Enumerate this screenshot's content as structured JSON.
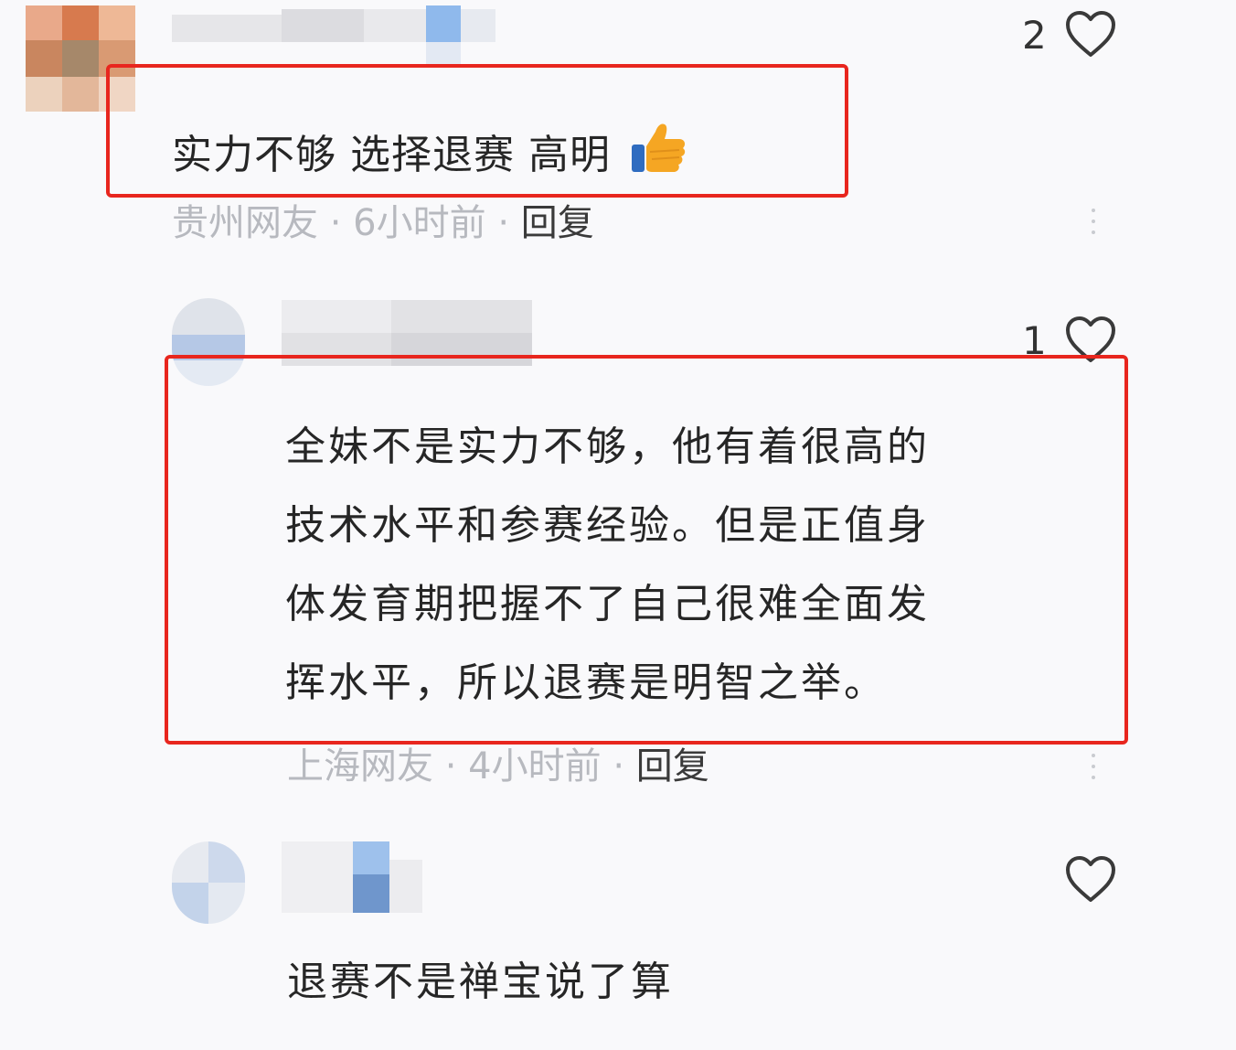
{
  "comments": [
    {
      "like_count": "2",
      "text": "实力不够 选择退赛 高明",
      "emoji": "thumbs-up",
      "location": "贵州网友",
      "time": "6小时前",
      "reply_label": "回复"
    },
    {
      "like_count": "1",
      "text_lines": [
        "全妹不是实力不够，他有着很高的",
        "技术水平和参赛经验。但是正值身",
        "体发育期把握不了自己很难全面发",
        "挥水平，所以退赛是明智之举。"
      ],
      "location": "上海网友",
      "time": "4小时前",
      "reply_label": "回复"
    },
    {
      "like_count": "",
      "text": "退赛不是禅宝说了算"
    }
  ],
  "separator": "·",
  "colors": {
    "highlight_border": "#e8261e",
    "meta_text": "#b7b9bf",
    "background": "#f9f9fb"
  }
}
